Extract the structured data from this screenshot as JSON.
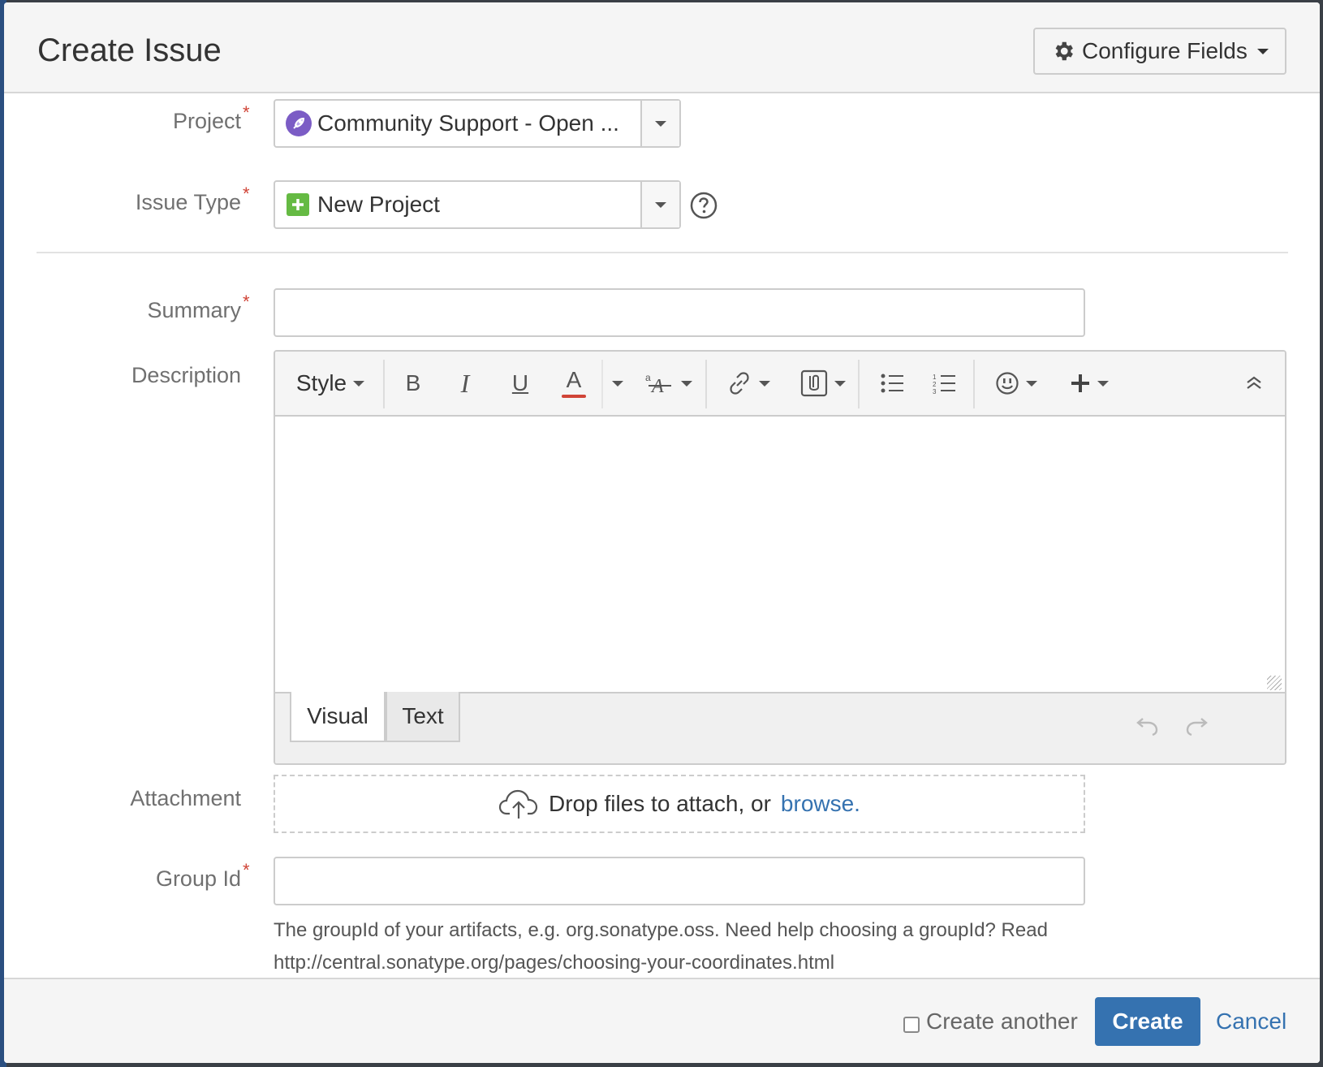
{
  "dialog": {
    "title": "Create Issue",
    "configure_fields_label": "Configure Fields"
  },
  "form": {
    "project": {
      "label": "Project",
      "required_marker": "*",
      "value": "Community Support - Open ..."
    },
    "issue_type": {
      "label": "Issue Type",
      "required_marker": "*",
      "value": "New Project"
    },
    "summary": {
      "label": "Summary",
      "required_marker": "*",
      "value": ""
    },
    "description": {
      "label": "Description",
      "toolbar": {
        "style_label": "Style",
        "bold": "B",
        "italic": "I",
        "underline": "U",
        "text_color": "A",
        "text_color_accent": "#d04437"
      },
      "tabs": [
        "Visual",
        "Text"
      ],
      "active_tab": "Visual"
    },
    "attachment": {
      "label": "Attachment",
      "drop_text": "Drop files to attach, or",
      "browse_link": "browse."
    },
    "group_id": {
      "label": "Group Id",
      "required_marker": "*",
      "value": "",
      "help_line1": "The groupId of your artifacts, e.g. org.sonatype.oss. Need help choosing a groupId? Read",
      "help_line2": "http://central.sonatype.org/pages/choosing-your-coordinates.html"
    }
  },
  "footer": {
    "create_another_label": "Create another",
    "create_another_checked": false,
    "create_label": "Create",
    "cancel_label": "Cancel"
  },
  "colors": {
    "primary": "#3572b0",
    "required": "#d04437",
    "issue_type_icon": "#65ba43"
  },
  "icons": {
    "config": "gear-icon",
    "project": "rocket-avatar-icon",
    "issue_type": "plus-square-icon",
    "help": "question-circle-icon",
    "attachment": "cloud-upload-icon"
  }
}
